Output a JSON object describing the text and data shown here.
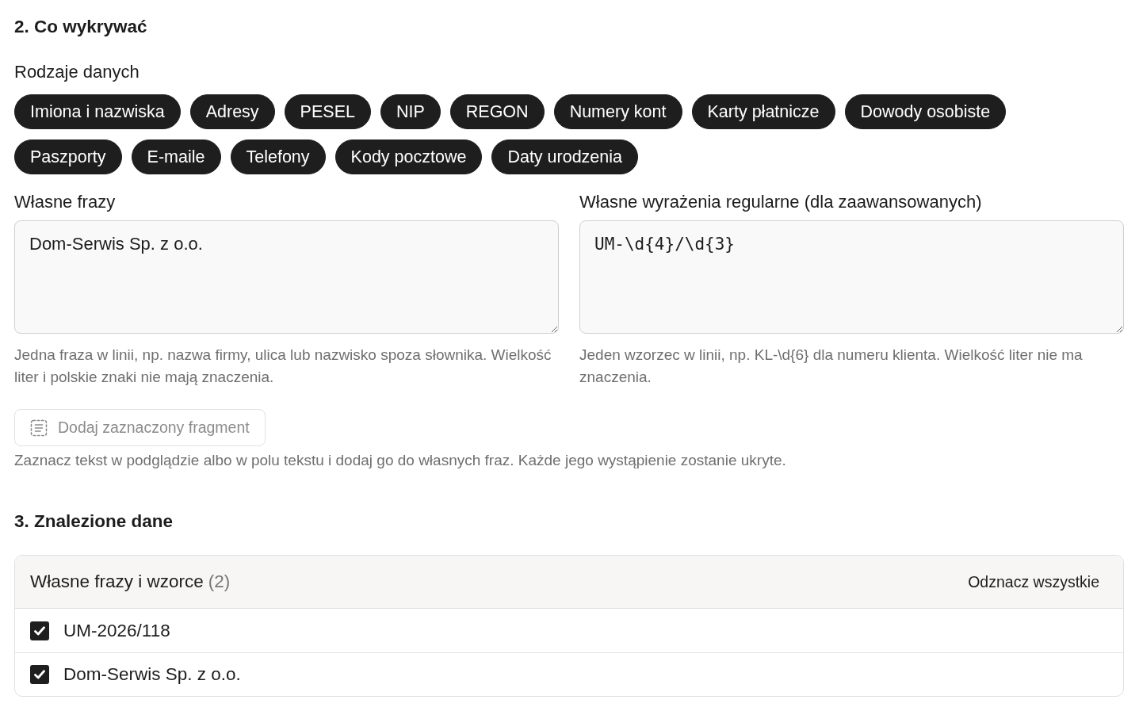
{
  "detect_section": {
    "title": "2. Co wykrywać",
    "data_types_label": "Rodzaje danych",
    "data_types": [
      {
        "label": "Imiona i nazwiska",
        "selected": true
      },
      {
        "label": "Adresy",
        "selected": true
      },
      {
        "label": "PESEL",
        "selected": true
      },
      {
        "label": "NIP",
        "selected": true
      },
      {
        "label": "REGON",
        "selected": true
      },
      {
        "label": "Numery kont",
        "selected": true
      },
      {
        "label": "Karty płatnicze",
        "selected": true
      },
      {
        "label": "Dowody osobiste",
        "selected": true
      },
      {
        "label": "Paszporty",
        "selected": true
      },
      {
        "label": "E-maile",
        "selected": true
      },
      {
        "label": "Telefony",
        "selected": true
      },
      {
        "label": "Kody pocztowe",
        "selected": true
      },
      {
        "label": "Daty urodzenia",
        "selected": true
      }
    ],
    "phrases": {
      "label": "Własne frazy",
      "value": "Dom-Serwis Sp. z o.o.",
      "hint": "Jedna fraza w linii, np. nazwa firmy, ulica lub nazwisko spoza słownika. Wielkość liter i polskie znaki nie mają znaczenia."
    },
    "patterns": {
      "label": "Własne wyrażenia regularne (dla zaawansowanych)",
      "value": "UM-\\d{4}/\\d{3}",
      "hint": "Jeden wzorzec w linii, np. KL-\\d{6} dla numeru klienta. Wielkość liter nie ma znaczenia."
    },
    "add_selection_button": {
      "label": "Dodaj zaznaczony fragment",
      "disabled": true
    },
    "add_selection_hint": "Zaznacz tekst w podglądzie albo w polu tekstu i dodaj go do własnych fraz. Każde jego wystąpienie zostanie ukryte."
  },
  "found_section": {
    "title": "3. Znalezione dane",
    "group": {
      "title": "Własne frazy i wzorce",
      "count": "(2)",
      "action": "Odznacz wszystkie",
      "items": [
        {
          "label": "UM-2026/118",
          "checked": true
        },
        {
          "label": "Dom-Serwis Sp. z o.o.",
          "checked": true
        }
      ]
    }
  }
}
